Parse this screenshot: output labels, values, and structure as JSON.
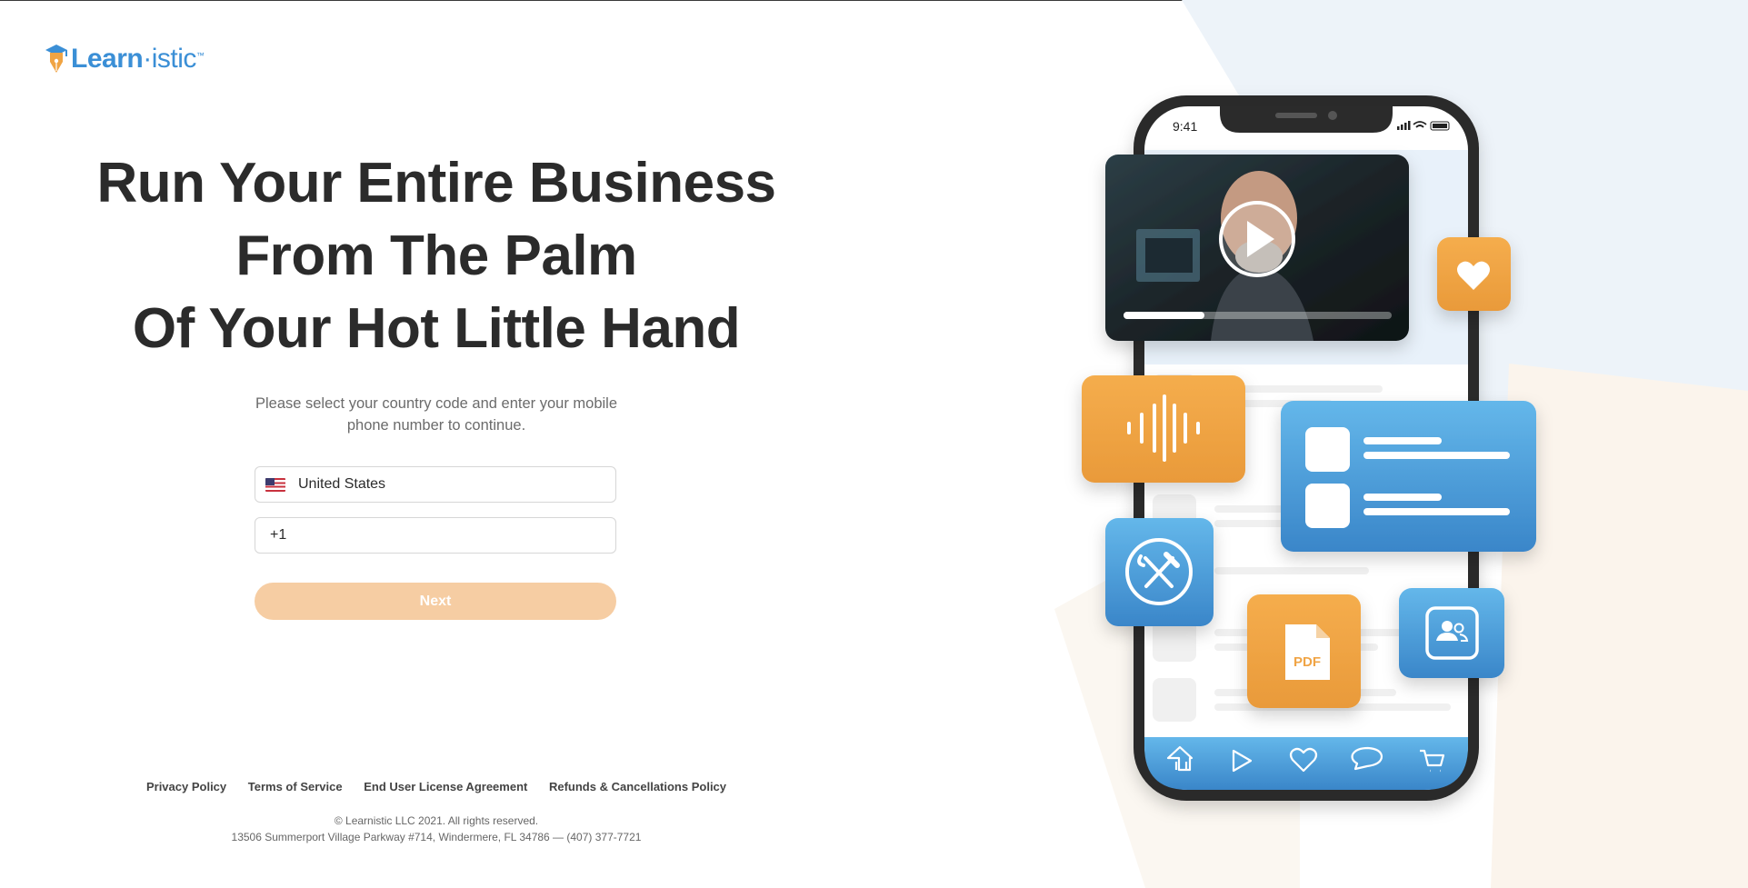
{
  "brand": {
    "name_bold": "Learn",
    "name_light": "·istic",
    "tm": "™"
  },
  "headline": {
    "line1": "Run Your Entire Business",
    "line2": "From The Palm",
    "line3": "Of Your Hot Little Hand"
  },
  "instructions": {
    "line1": "Please select your country code and enter your mobile",
    "line2": "phone number to continue."
  },
  "form": {
    "country_value": "United States",
    "country_flag": "us-flag-icon",
    "phone_value": "+1",
    "next_label": "Next"
  },
  "footer": {
    "links": [
      "Privacy Policy",
      "Terms of Service",
      "End User License Agreement",
      "Refunds & Cancellations Policy"
    ],
    "copyright": "© Learnistic LLC 2021. All rights reserved.",
    "address": "13506 Summerport Village Parkway #714, Windermere, FL 34786 — (407) 377-7721"
  },
  "phone_mockup": {
    "status_time": "9:41",
    "pdf_label": "PDF",
    "tabbar_icons": [
      "home-icon",
      "play-icon",
      "heart-icon",
      "chat-icon",
      "cart-icon"
    ]
  },
  "colors": {
    "brand_blue": "#3b8fd6",
    "accent_orange": "#f0a444",
    "button_disabled": "#f6cda3",
    "heading": "#2b2b2b"
  }
}
